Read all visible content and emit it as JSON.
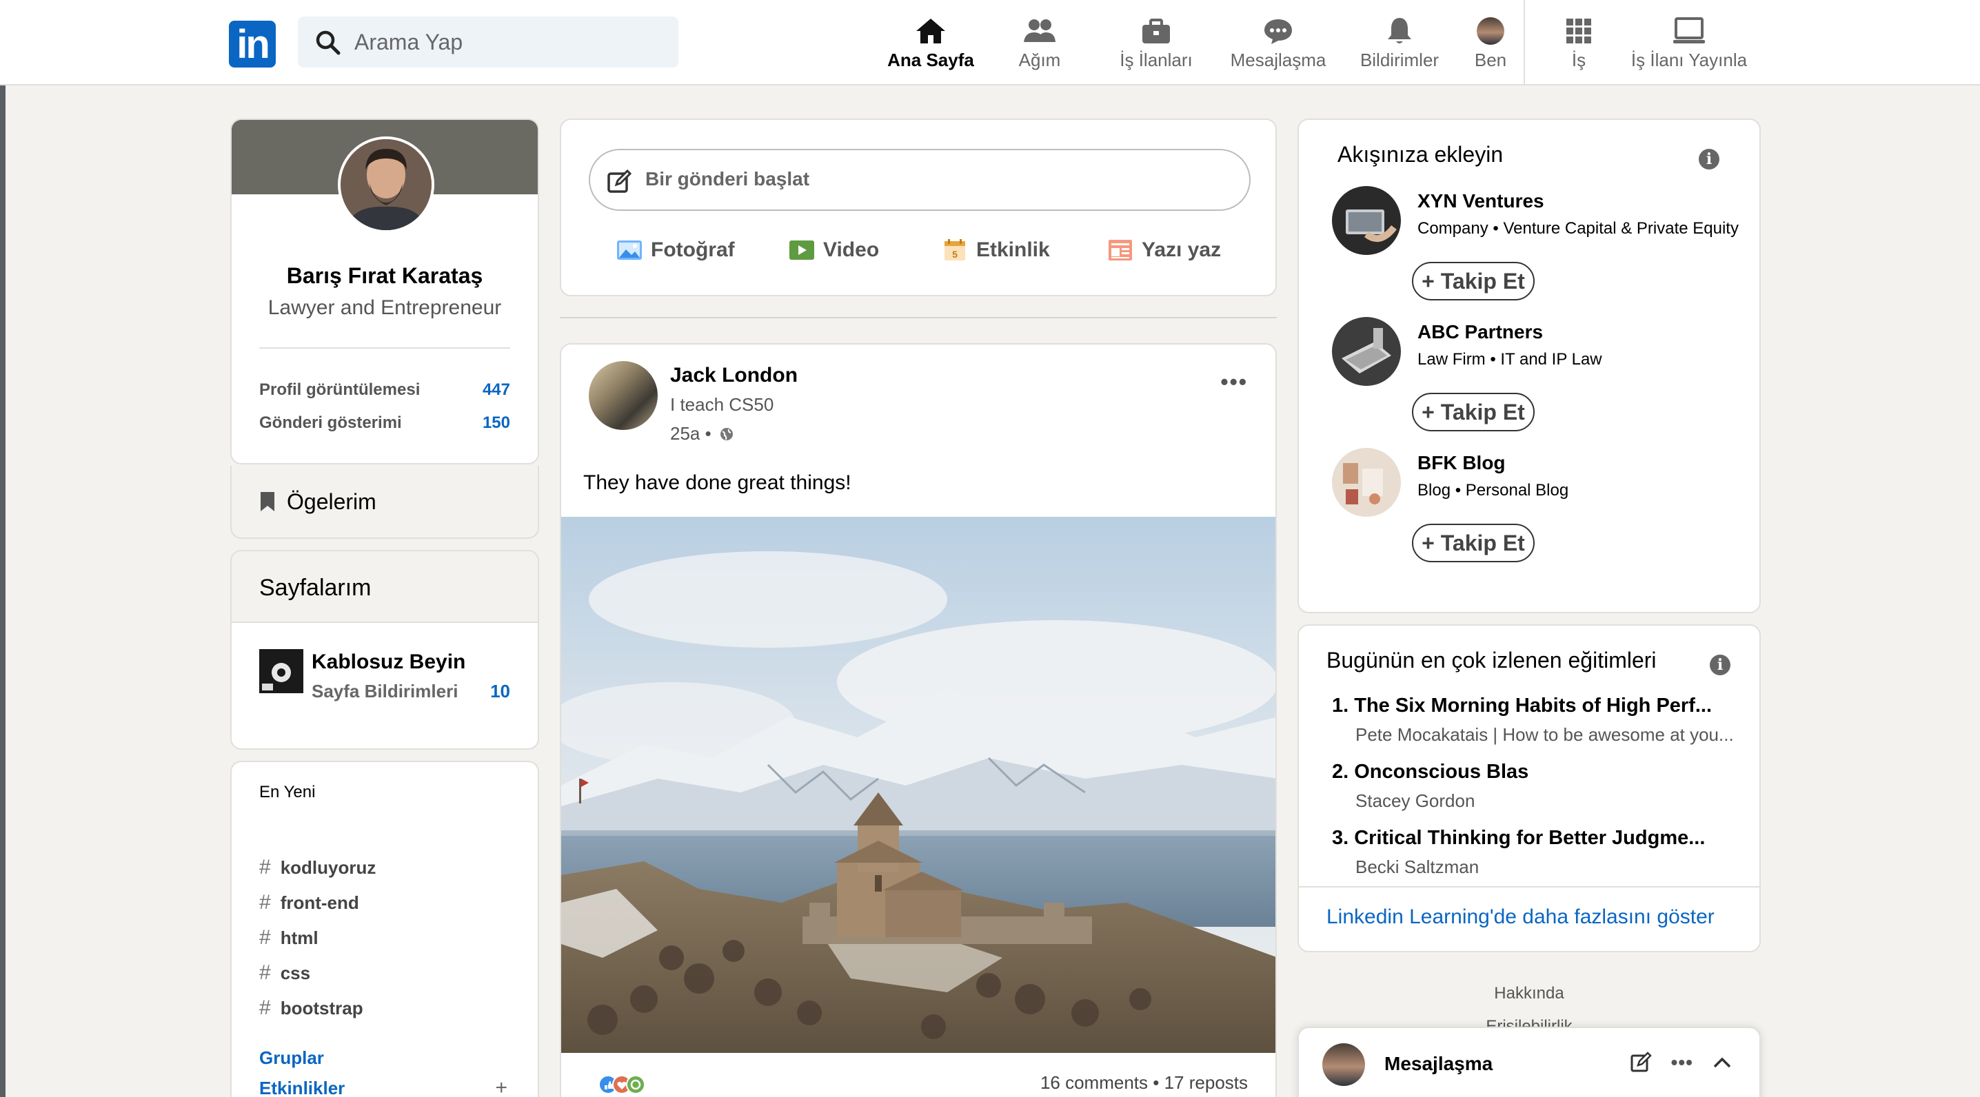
{
  "nav": {
    "search_placeholder": "Arama Yap",
    "items": [
      {
        "label": "Ana Sayfa",
        "icon": "home-icon"
      },
      {
        "label": "Ağım",
        "icon": "people-icon"
      },
      {
        "label": "İş İlanları",
        "icon": "briefcase-icon"
      },
      {
        "label": "Mesajlaşma",
        "icon": "chat-icon"
      },
      {
        "label": "Bildirimler",
        "icon": "bell-icon"
      },
      {
        "label": "Ben",
        "icon": "me-avatar"
      },
      {
        "label": "İş",
        "icon": "grid-icon"
      },
      {
        "label": "İş İlanı Yayınla",
        "icon": "post-job-icon"
      }
    ],
    "colors": {
      "brand": "#0a66c2",
      "background": "#f3f2ef"
    }
  },
  "profile": {
    "name": "Barış Fırat Karataş",
    "headline": "Lawyer and Entrepreneur",
    "stats": [
      {
        "label": "Profil görüntülemesi",
        "value": "447"
      },
      {
        "label": "Gönderi gösterimi",
        "value": "150"
      }
    ],
    "items_label": "Ögelerim"
  },
  "pages": {
    "title": "Sayfalarım",
    "page_name": "Kablosuz Beyin",
    "notifications_label": "Sayfa Bildirimleri",
    "notifications_count": "10"
  },
  "recent": {
    "title": "En Yeni",
    "hashtags": [
      "kodluyoruz",
      "front-end",
      "html",
      "css",
      "bootstrap"
    ],
    "links": [
      "Gruplar",
      "Etkinlikler"
    ]
  },
  "composer": {
    "placeholder": "Bir gönderi başlat",
    "actions": [
      {
        "label": "Fotoğraf",
        "icon": "photo-icon"
      },
      {
        "label": "Video",
        "icon": "video-icon"
      },
      {
        "label": "Etkinlik",
        "icon": "calendar-icon"
      },
      {
        "label": "Yazı yaz",
        "icon": "article-icon"
      }
    ]
  },
  "post": {
    "author": "Jack London",
    "author_subtitle": "I teach CS50",
    "time": "25a •",
    "text": "They have done great things!",
    "comments": "16 comments",
    "reposts": "17 reposts",
    "separator": "•"
  },
  "feed_suggestions": {
    "title": "Akışınıza ekleyin",
    "follow_label": "+ Takip Et",
    "items": [
      {
        "name": "XYN Ventures",
        "subtitle": "Company • Venture Capital & Private Equity"
      },
      {
        "name": "ABC Partners",
        "subtitle": "Law Firm • IT and IP Law"
      },
      {
        "name": "BFK Blog",
        "subtitle": "Blog • Personal Blog"
      }
    ]
  },
  "learning": {
    "title": "Bugünün en çok izlenen eğitimleri",
    "courses": [
      {
        "title": "1. The Six Morning Habits of High Perf...",
        "author": "Pete Mocakatais | How to be awesome at you..."
      },
      {
        "title": "2. Onconscious Blas",
        "author": "Stacey Gordon"
      },
      {
        "title": "3. Critical Thinking for Better Judgme...",
        "author": "Becki Saltzman"
      }
    ],
    "more_label": "Linkedin Learning'de daha fazlasını göster"
  },
  "footer": {
    "links": [
      "Hakkında",
      "Erişilebilirlik"
    ]
  },
  "messaging": {
    "label": "Mesajlaşma"
  }
}
